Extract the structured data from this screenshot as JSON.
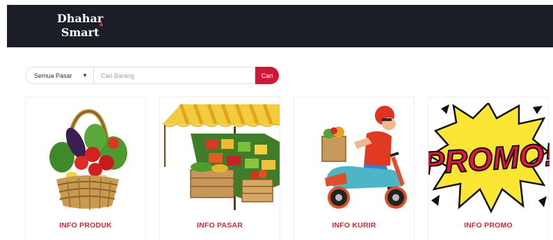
{
  "header": {
    "brand_line1": "Dhahar",
    "brand_line2": "Smart",
    "accent_color": "#e0213b",
    "background_color": "#1b1d27"
  },
  "search": {
    "market_selected": "Semua Pasar",
    "input_placeholder": "Cari Barang",
    "input_value": "",
    "button_label": "Cari",
    "button_color": "#d31636"
  },
  "cards": [
    {
      "label": "INFO PRODUK",
      "icon": "vegetable-basket-icon"
    },
    {
      "label": "INFO PASAR",
      "icon": "market-stall-icon"
    },
    {
      "label": "INFO KURIR",
      "icon": "courier-scooter-icon"
    },
    {
      "label": "INFO PROMO",
      "icon": "promo-burst-icon"
    }
  ],
  "promo_graphic_text": "PROMO!",
  "label_color": "#d62434"
}
